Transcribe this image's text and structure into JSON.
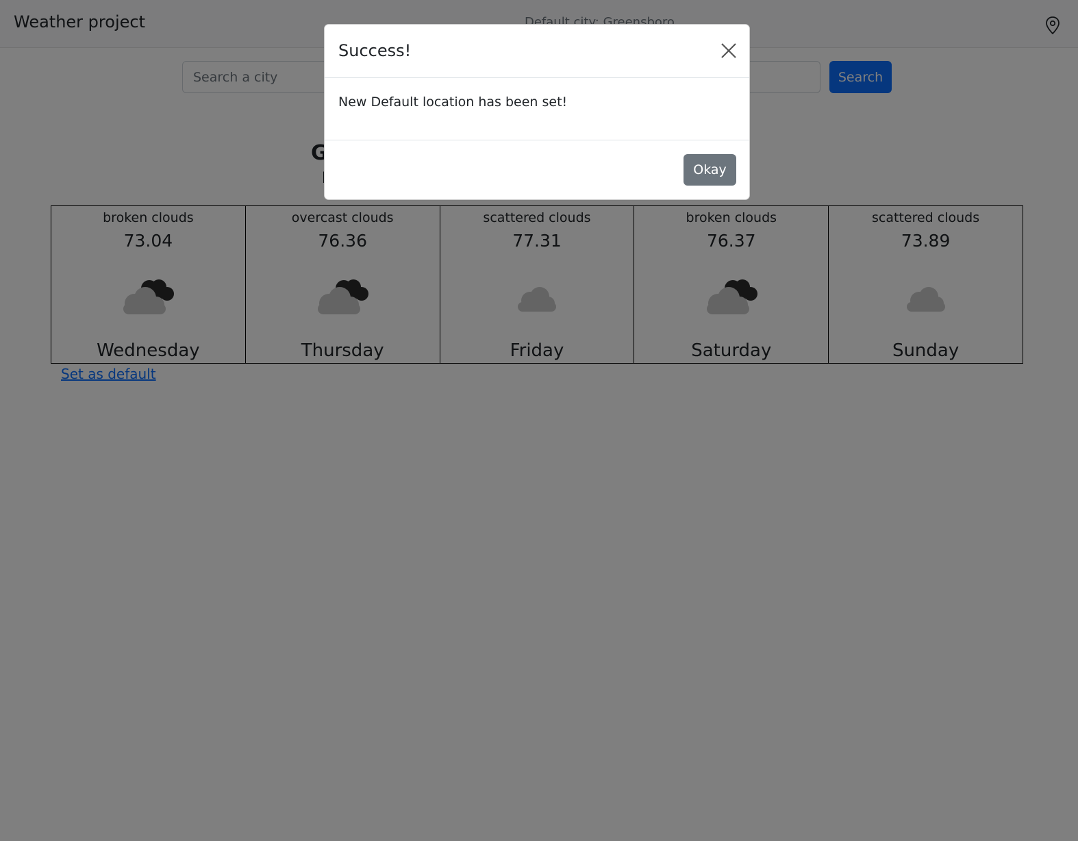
{
  "navbar": {
    "brand": "Weather project",
    "default_city": "Default city: Greensboro",
    "location_icon": "map-pin-icon"
  },
  "search": {
    "placeholder": "Search a city",
    "button_label": "Search"
  },
  "current": {
    "city": "G",
    "sub": "I"
  },
  "forecast": [
    {
      "description": "broken clouds",
      "temp": "73.04",
      "day": "Wednesday",
      "icon": "broken-clouds-icon"
    },
    {
      "description": "overcast clouds",
      "temp": "76.36",
      "day": "Thursday",
      "icon": "overcast-clouds-icon"
    },
    {
      "description": "scattered clouds",
      "temp": "77.31",
      "day": "Friday",
      "icon": "scattered-clouds-icon"
    },
    {
      "description": "broken clouds",
      "temp": "76.37",
      "day": "Saturday",
      "icon": "broken-clouds-icon"
    },
    {
      "description": "scattered clouds",
      "temp": "73.89",
      "day": "Sunday",
      "icon": "scattered-clouds-icon"
    }
  ],
  "set_default_link": "Set as default",
  "modal": {
    "title": "Success!",
    "message": "New Default location has been set!",
    "ok_label": "Okay",
    "close_icon": "close-icon"
  },
  "colors": {
    "primary": "#0d6efd",
    "secondary": "#6c757d",
    "backdrop": "rgba(0,0,0,0.5)"
  }
}
